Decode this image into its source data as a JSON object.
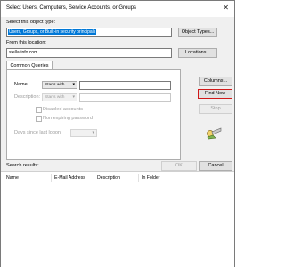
{
  "window": {
    "title": "Select Users, Computers, Service Accounts, or Groups",
    "close_glyph": "✕"
  },
  "object_type": {
    "label": "Select this object type:",
    "value": "Users, Groups, or Built-in security principals",
    "button": "Object Types..."
  },
  "location": {
    "label": "From this location:",
    "value": "stellarinfo.com",
    "button": "Locations..."
  },
  "tabs": [
    {
      "label": "Common Queries"
    }
  ],
  "query": {
    "name_label": "Name:",
    "name_mode": "Starts with",
    "name_value": "",
    "description_label": "Description:",
    "description_mode": "Starts with",
    "description_value": "",
    "disabled_accounts_label": "Disabled accounts",
    "non_expiring_label": "Non expiring password",
    "days_label": "Days since last logon:",
    "days_value": ""
  },
  "side_buttons": {
    "columns": "Columns...",
    "find_now": "Find Now",
    "stop": "Stop"
  },
  "footer_buttons": {
    "ok": "OK",
    "cancel": "Cancel"
  },
  "results": {
    "label": "Search results:",
    "columns": [
      "Name",
      "E-Mail Address",
      "Description",
      "In Folder"
    ]
  },
  "icons": {
    "search_icon": "search-figure-icon"
  },
  "colors": {
    "selection": "#0078d7",
    "highlight_border": "#d01919"
  }
}
